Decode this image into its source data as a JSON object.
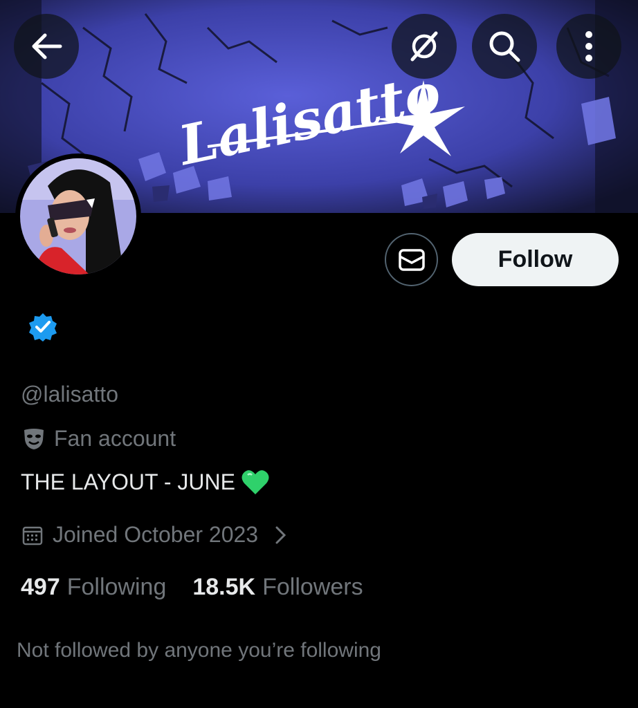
{
  "header": {
    "banner_logo_text": "Lalisatto",
    "back_icon": "arrow-left-icon",
    "grok_icon": "grok-icon",
    "search_icon": "search-icon",
    "more_icon": "more-vertical-icon"
  },
  "profile": {
    "handle": "@lalisatto",
    "verified": true,
    "verified_color": "#1d9bf0",
    "label_icon": "mask-icon",
    "label": "Fan account",
    "bio_text": "THE LAYOUT - JUNE",
    "bio_emoji": "green-heart-icon",
    "joined_icon": "calendar-icon",
    "joined": "Joined October 2023",
    "following_count": "497",
    "following_label": "Following",
    "followers_count": "18.5K",
    "followers_label": "Followers",
    "not_followed_text": "Not followed by anyone you’re following"
  },
  "actions": {
    "message_icon": "envelope-icon",
    "follow_label": "Follow"
  },
  "colors": {
    "background": "#000000",
    "text_primary": "#e7e9ea",
    "text_secondary": "#71767b",
    "follow_bg": "#eff3f4",
    "banner_blue": "#4a4fc0"
  }
}
